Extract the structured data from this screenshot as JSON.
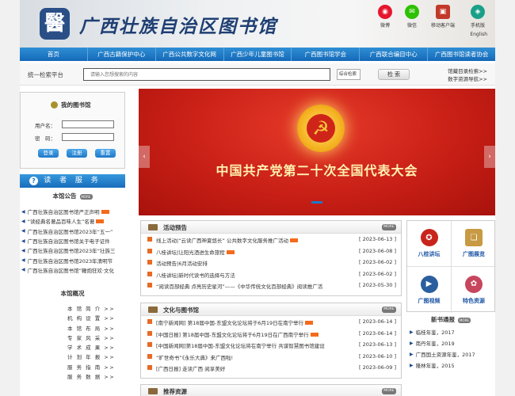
{
  "header": {
    "logo_seal": "醫",
    "logo_text": "广西壮族自治区图书馆",
    "links": [
      {
        "label": "微博",
        "icon": "weibo-icon",
        "color": "#e6162d",
        "glyph": "◉"
      },
      {
        "label": "微信",
        "icon": "wechat-icon",
        "color": "#2dc100",
        "glyph": "✉"
      },
      {
        "label": "移动客户端",
        "icon": "mobile-client-icon",
        "color": "#c2392b",
        "glyph": "▣"
      },
      {
        "label": "手机版",
        "icon": "mobile-icon",
        "color": "#1aa089",
        "glyph": "◈"
      }
    ],
    "english": "English"
  },
  "nav": [
    "首页",
    "广西古籍保护中心",
    "广西公共数字文化网",
    "广西少年儿童图书馆",
    "广西图书馆学会",
    "广西联合编目中心",
    "广西图书馆读者协会"
  ],
  "search": {
    "label": "统一检索平台",
    "placeholder": "请输入您想搜索的内容",
    "select_value": "综合检索",
    "button": "检 索",
    "links": [
      "馆藏目录检索>>",
      "数字资源导航>>"
    ]
  },
  "login": {
    "title": "我的图书馆",
    "username_label": "用户名：",
    "password_label": "密　码：",
    "buttons": [
      "登录",
      "注册",
      "重置"
    ]
  },
  "service_title": "读 者 服 务",
  "announcement": {
    "title": "本馆公告",
    "more": "MORE",
    "items": [
      "广西壮族自治区图书馆严正声明",
      "“读经典名著品百味人生”名著",
      "广西壮族自治区图书馆2023年“五一”",
      "广西壮族自治区图书馆关于电子证件",
      "广西壮族自治区图书馆2023年“壮族三",
      "广西壮族自治区图书馆2023年清明节",
      "广西壮族自治区图书馆“鞭炮狂欢·文化"
    ]
  },
  "overview": {
    "title": "本馆概况",
    "items": [
      "本 馆 简 介 >>",
      "机 构 设 置 >>",
      "本 馆 布 局 >>",
      "专 家 风 采 >>",
      "学 术 成 果 >>",
      "计 划 年 报 >>",
      "服 务 指 南 >>",
      "服 务 数 据 >>"
    ]
  },
  "banner": {
    "text": "中国共产党第二十次全国代表大会",
    "emblem": "☭",
    "prev": "‹",
    "next": "›"
  },
  "activity": {
    "title": "活动预告",
    "more": "MORE",
    "rows": [
      {
        "text": "线上活动|“云读广西神夏悠长” 公共数字文化服务推广活动",
        "date": "[ 2023-06-13 ]",
        "new": true
      },
      {
        "text": "八桂讲坛|让阳光洒进生命旅程",
        "date": "[ 2023-06-08 ]",
        "new": true
      },
      {
        "text": "活动预告|6月活动安排",
        "date": "[ 2023-06-02 ]",
        "new": false
      },
      {
        "text": "八桂讲坛|新时代读书的选择与方法",
        "date": "[ 2023-06-02 ]",
        "new": false
      },
      {
        "text": "“阅读百部经典 点亮历史星河”——《中华传统文化百部经典》阅读推广活",
        "date": "[ 2023-05-30 ]",
        "new": false
      }
    ]
  },
  "culture": {
    "title": "文化与图书馆",
    "more": "MORE",
    "rows": [
      {
        "text": "[南宁新闻网] 第18届中国-东盟文化论坛将于6月19日在南宁举行",
        "date": "[ 2023-06-14 ]",
        "new": true
      },
      {
        "text": "[中国日报] 第18届中国-东盟文化论坛将于6月19日在广西南宁举行",
        "date": "[ 2023-06-14 ]",
        "new": true
      },
      {
        "text": "[中国新闻网]第18届中国-东盟文化论坛将在南宁举行 共谋智慧图书馆建设",
        "date": "[ 2023-06-13 ]",
        "new": false
      },
      {
        "text": "“旷世奇书”《永乐大典》来广西啦!",
        "date": "[ 2023-06-10 ]",
        "new": false
      },
      {
        "text": "[广西日报] 走读广西 阅享美好",
        "date": "[ 2023-06-09 ]",
        "new": false
      }
    ]
  },
  "resources": {
    "title": "推荐资源",
    "more": "MORE"
  },
  "icon_grid": [
    {
      "label": "八桂讲坛",
      "icon": "bagui-forum-icon",
      "color": "#c9241b",
      "glyph": "✪"
    },
    {
      "label": "广图展览",
      "icon": "exhibition-icon",
      "color": "#c79a43",
      "glyph": "❏"
    },
    {
      "label": "广图视频",
      "icon": "video-icon",
      "color": "#2b5e9e",
      "glyph": "▶"
    },
    {
      "label": "特色资源",
      "icon": "feature-resource-icon",
      "color": "#c7465d",
      "glyph": "✿"
    }
  ],
  "new_books": {
    "title": "新书通报",
    "more": "MORE",
    "items": [
      "临桂年鉴，2017",
      "南丹年鉴，2019",
      "广西国土资源年鉴，2017",
      "隆林年鉴，2015"
    ]
  }
}
